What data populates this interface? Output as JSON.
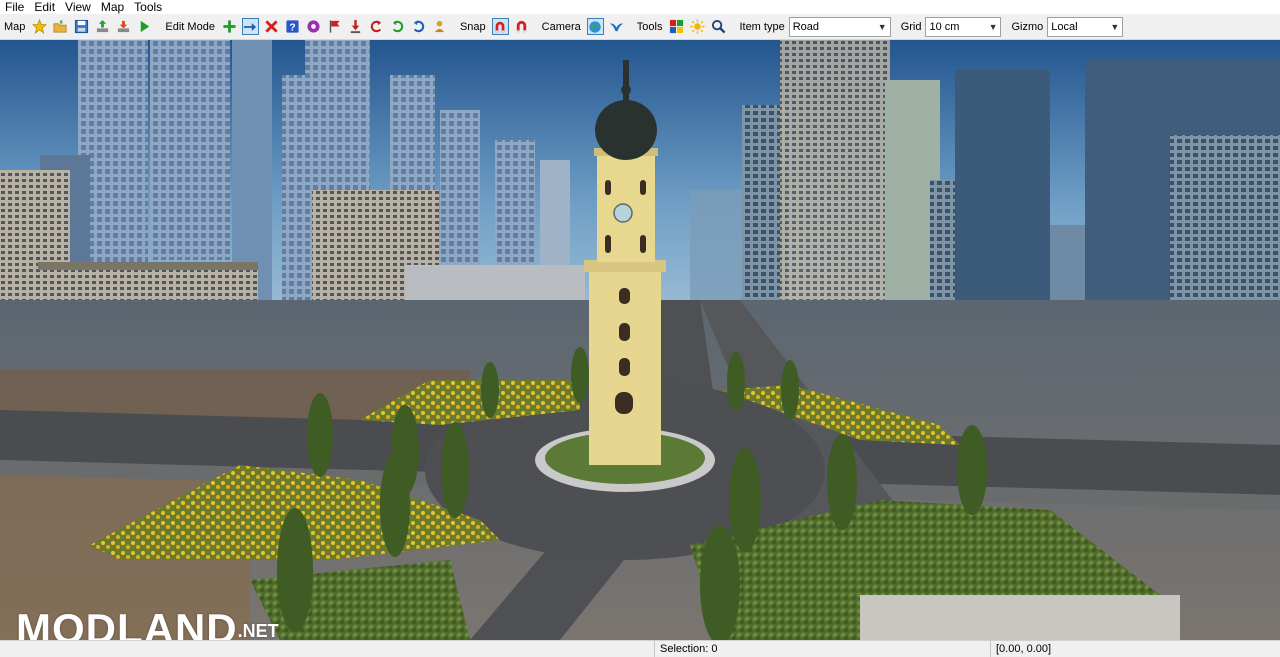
{
  "menu": {
    "items": [
      "File",
      "Edit",
      "View",
      "Map",
      "Tools"
    ]
  },
  "toolbar": {
    "map_label": "Map",
    "edit_mode_label": "Edit Mode",
    "snap_label": "Snap",
    "camera_label": "Camera",
    "tools_label": "Tools",
    "item_type_label": "Item type",
    "item_type_value": "Road",
    "grid_label": "Grid",
    "grid_value": "10 cm",
    "gizmo_label": "Gizmo",
    "gizmo_value": "Local",
    "icons": {
      "favorite": "star-icon",
      "open": "open-folder-icon",
      "save": "save-icon",
      "export": "export-icon",
      "import": "import-icon",
      "run": "play-icon",
      "add": "plus-icon",
      "move": "arrow-right-icon",
      "delete": "delete-icon",
      "help": "help-icon",
      "web": "web-icon",
      "flag": "flag-icon",
      "place": "place-icon",
      "rotate_left": "rotate-left-icon",
      "rotate_right": "rotate-right-icon",
      "rotate_reset": "rotate-reset-icon",
      "person": "person-icon",
      "snap_magnet": "magnet-icon",
      "snap_magnet_off": "magnet-off-icon",
      "camera_globe": "globe-icon",
      "camera_bird": "bird-icon",
      "palette": "palette-icon",
      "sun": "sun-icon",
      "search": "search-icon"
    }
  },
  "status": {
    "selection": "Selection: 0",
    "coordinates": "[0.00, 0.00]"
  },
  "watermark": {
    "main": "MODLAND",
    "suffix": ".NET"
  },
  "colors": {
    "active_button_border": "#3c7fb1",
    "active_button_fill": "#cce4f7"
  }
}
